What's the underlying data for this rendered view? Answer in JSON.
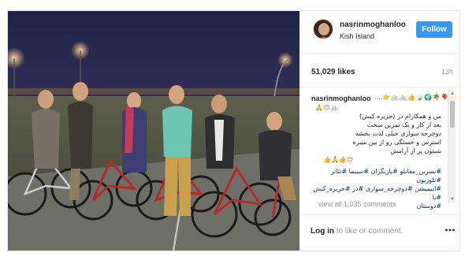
{
  "header": {
    "username": "nasrinmoghanloo",
    "location": "Kish Island",
    "follow_label": "Follow"
  },
  "stats": {
    "likes": "51,029 likes",
    "time_ago": "13h"
  },
  "caption": {
    "username": "nasrinmoghanloo",
    "emoji_row_1": "....👉🚲🚲👍🍃🌍🌴🎈🌞",
    "emoji_row_2": "🙏😍🚲",
    "lines": [
      "من و همکارام در (جزیره کیش)",
      "بعد از کار و یک تمرین سخت",
      "دوچرخه سواری خیلی لذت بخشه",
      "استرس و خستگی رو از بین میبره",
      "شبتون پر از آرامش"
    ],
    "emoji_row_3": "👍🙏👍😍",
    "hashtags": [
      "#نسرین_مقانلو #بازیگران #سینما #تئاتر #تلوزیون",
      "#انیمیشن #دوچرخه_سواری #در #جزیره_کیش #با",
      "#دوستان"
    ],
    "view_all": "view all 1,035 comments"
  },
  "footer": {
    "login_link": "Log in",
    "login_rest": "to like or comment."
  },
  "icons": {
    "more": "more-options-icon",
    "scroll_up": "scroll-up-icon",
    "scroll_down": "scroll-down-icon"
  },
  "colors": {
    "follow_button": "#3897f0",
    "hashtag": "#003569",
    "muted": "#999999"
  }
}
